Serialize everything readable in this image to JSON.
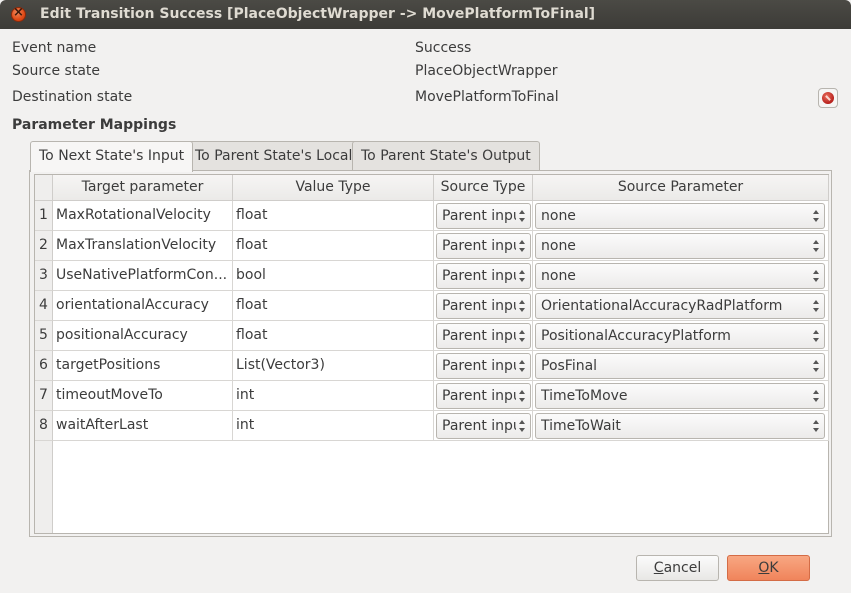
{
  "window": {
    "title": "Edit Transition Success [PlaceObjectWrapper -> MovePlatformToFinal]"
  },
  "info": {
    "event_name_label": "Event name",
    "event_name_value": "Success",
    "source_state_label": "Source state",
    "source_state_value": "PlaceObjectWrapper",
    "destination_state_label": "Destination state",
    "destination_state_value": "MovePlatformToFinal"
  },
  "section_title": "Parameter Mappings",
  "tabs": [
    {
      "label": "To Next State's Input",
      "active": true
    },
    {
      "label": "To Parent State's Local",
      "active": false
    },
    {
      "label": "To Parent State's Output",
      "active": false
    }
  ],
  "table": {
    "headers": [
      "Target parameter",
      "Value Type",
      "Source Type",
      "Source Parameter"
    ],
    "rows": [
      {
        "num": "1",
        "target": "MaxRotationalVelocity",
        "value_type": "float",
        "source_type": "Parent input",
        "source_param": "none"
      },
      {
        "num": "2",
        "target": "MaxTranslationVelocity",
        "value_type": "float",
        "source_type": "Parent input",
        "source_param": "none"
      },
      {
        "num": "3",
        "target": "UseNativePlatformCon...",
        "value_type": "bool",
        "source_type": "Parent input",
        "source_param": "none"
      },
      {
        "num": "4",
        "target": "orientationalAccuracy",
        "value_type": "float",
        "source_type": "Parent input",
        "source_param": "OrientationalAccuracyRadPlatform"
      },
      {
        "num": "5",
        "target": "positionalAccuracy",
        "value_type": "float",
        "source_type": "Parent input",
        "source_param": "PositionalAccuracyPlatform"
      },
      {
        "num": "6",
        "target": "targetPositions",
        "value_type": "List(Vector3)",
        "source_type": "Parent input",
        "source_param": "PosFinal"
      },
      {
        "num": "7",
        "target": "timeoutMoveTo",
        "value_type": "int",
        "source_type": "Parent input",
        "source_param": "TimeToMove"
      },
      {
        "num": "8",
        "target": "waitAfterLast",
        "value_type": "int",
        "source_type": "Parent input",
        "source_param": "TimeToWait"
      }
    ]
  },
  "buttons": {
    "cancel_mnemonic": "C",
    "cancel_rest": "ancel",
    "ok_mnemonic": "O",
    "ok_rest": "K"
  },
  "colors": {
    "titlebar": "#3c3b37",
    "ok_accent": "#f0845b",
    "close_button": "#df4a16"
  }
}
